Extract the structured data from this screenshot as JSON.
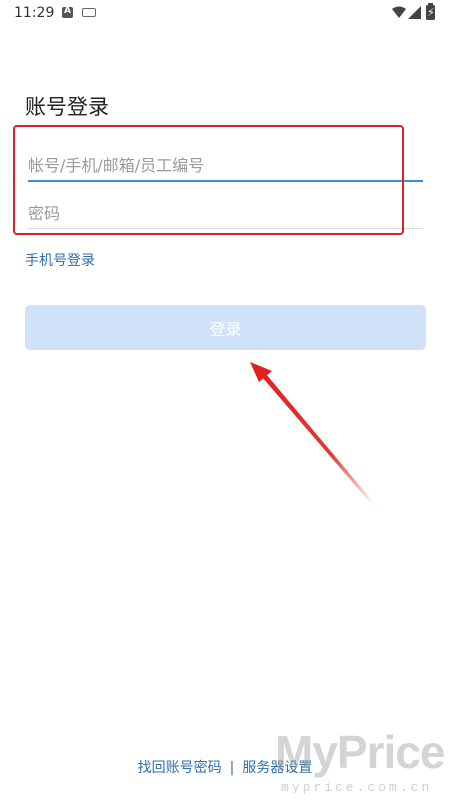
{
  "status_bar": {
    "time": "11:29",
    "icons": [
      "notification-a-icon",
      "keyboard-icon",
      "wifi-icon",
      "signal-icon",
      "battery-charging-icon"
    ]
  },
  "page": {
    "title": "账号登录"
  },
  "form": {
    "account_placeholder": "帐号/手机/邮箱/员工编号",
    "account_value": "",
    "password_placeholder": "密码",
    "password_value": "",
    "phone_login_label": "手机号登录",
    "login_button_label": "登录"
  },
  "footer": {
    "retrieve_label": "找回账号密码",
    "separator": "|",
    "server_settings_label": "服务器设置"
  },
  "watermark": {
    "brand": "MyPrice",
    "url": "myprice.com.cn"
  },
  "colors": {
    "accent": "#3a8fd8",
    "link": "#2f6fae",
    "button_disabled": "#cfe2f8",
    "annotation_red": "#e02020"
  }
}
